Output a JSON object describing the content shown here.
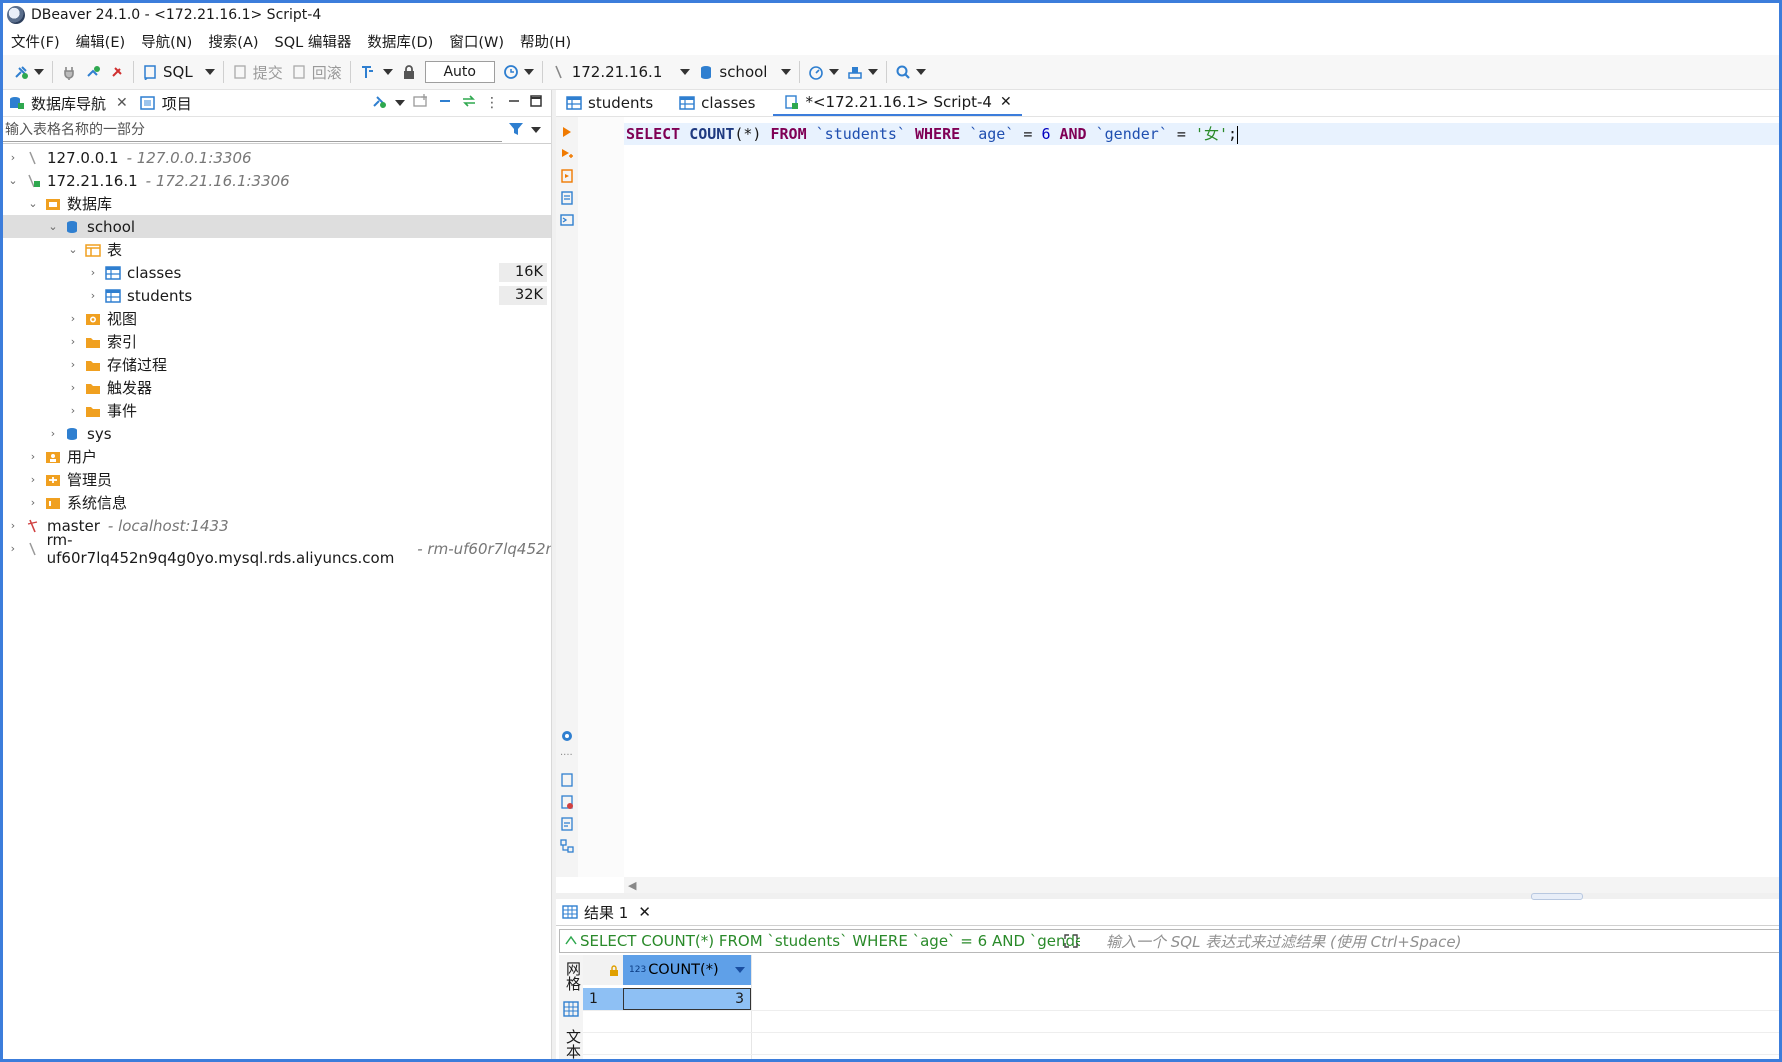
{
  "window": {
    "title": "DBeaver 24.1.0 - <172.21.16.1> Script-4"
  },
  "menu": [
    "文件(F)",
    "编辑(E)",
    "导航(N)",
    "搜索(A)",
    "SQL 编辑器",
    "数据库(D)",
    "窗口(W)",
    "帮助(H)"
  ],
  "toolbar": {
    "sql_label": "SQL",
    "commit_label": "提交",
    "rollback_label": "回滚",
    "mode_value": "Auto",
    "connection_label": "172.21.16.1",
    "schema_label": "school"
  },
  "navigator": {
    "tab_label": "数据库导航",
    "projects_tab_label": "项目",
    "filter_placeholder": "输入表格名称的一部分",
    "tree": [
      {
        "label": "127.0.0.1",
        "sub": "- 127.0.0.1:3306"
      },
      {
        "label": "172.21.16.1",
        "sub": "- 172.21.16.1:3306"
      },
      {
        "label": "数据库"
      },
      {
        "label": "school"
      },
      {
        "label": "表"
      },
      {
        "label": "classes",
        "size": "16K"
      },
      {
        "label": "students",
        "size": "32K"
      },
      {
        "label": "视图"
      },
      {
        "label": "索引"
      },
      {
        "label": "存储过程"
      },
      {
        "label": "触发器"
      },
      {
        "label": "事件"
      },
      {
        "label": "sys"
      },
      {
        "label": "用户"
      },
      {
        "label": "管理员"
      },
      {
        "label": "系统信息"
      },
      {
        "label": "master",
        "sub": "- localhost:1433"
      },
      {
        "label": "rm-uf60r7lq452n9q4g0yo.mysql.rds.aliyuncs.com",
        "sub": "- rm-uf60r7lq452n"
      }
    ]
  },
  "editor": {
    "tabs": [
      {
        "label": "students"
      },
      {
        "label": "classes"
      },
      {
        "label": "*<172.21.16.1> Script-4"
      }
    ],
    "code": {
      "t1": "SELECT",
      "t2": "COUNT",
      "t3": "(*)",
      "t4": "FROM",
      "t5": "`students`",
      "t6": "WHERE",
      "t7": "`age`",
      "t8": "=",
      "t9": "6",
      "t10": "AND",
      "t11": "`gender`",
      "t12": "=",
      "t13": "'女'",
      "t14": ";"
    }
  },
  "results": {
    "tab_label": "结果 1",
    "query_text": "SELECT COUNT(*) FROM `students` WHERE `age` = 6 AND `gender",
    "filter_placeholder": "输入一个 SQL 表达式来过滤结果 (使用 Ctrl+Space)",
    "side_grid_label": "网格",
    "side_text_label": "文本",
    "column": {
      "type_badge": "123",
      "name": "COUNT(*)"
    },
    "rows": [
      {
        "num": "1",
        "value": "3"
      }
    ]
  },
  "colors": {
    "accent": "#3c7ddb",
    "selection": "#8ec0f4",
    "header": "#5fa0e8"
  }
}
